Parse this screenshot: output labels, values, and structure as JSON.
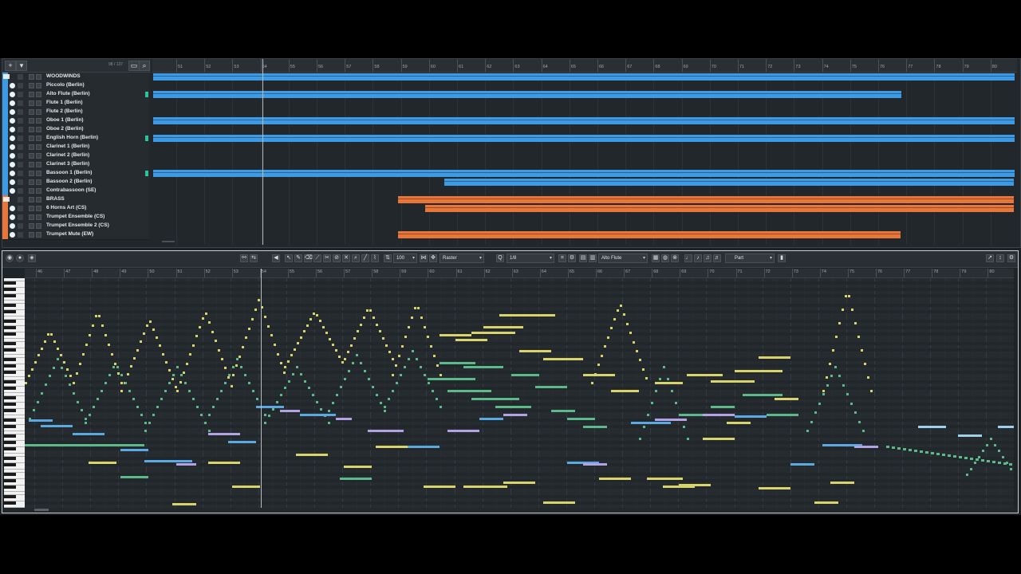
{
  "arrange": {
    "track_count": "98 / 137",
    "tracks": [
      {
        "name": "WOODWINDS",
        "kind": "folder",
        "color": "#3d9be6"
      },
      {
        "name": "Piccolo (Berlin)",
        "color": "#3d9be6"
      },
      {
        "name": "Alto Flute (Berlin)",
        "color": "#3d9be6"
      },
      {
        "name": "Flute 1 (Berlin)",
        "color": "#3d9be6"
      },
      {
        "name": "Flute 2 (Berlin)",
        "color": "#3d9be6"
      },
      {
        "name": "Oboe 1 (Berlin)",
        "color": "#3d9be6"
      },
      {
        "name": "Oboe 2 (Berlin)",
        "color": "#3d9be6"
      },
      {
        "name": "English Horn (Berlin)",
        "color": "#3d9be6"
      },
      {
        "name": "Clarinet 1 (Berlin)",
        "color": "#3d9be6"
      },
      {
        "name": "Clarinet 2 (Berlin)",
        "color": "#3d9be6"
      },
      {
        "name": "Clarinet 3 (Berlin)",
        "color": "#3d9be6"
      },
      {
        "name": "Bassoon 1 (Berlin)",
        "color": "#3d9be6"
      },
      {
        "name": "Bassoon 2 (Berlin)",
        "color": "#3d9be6"
      },
      {
        "name": "Contrabassoon (SE)",
        "color": "#3d9be6"
      },
      {
        "name": "BRASS",
        "kind": "folder",
        "color": "#e8763a"
      },
      {
        "name": "6 Horns Art (CS)",
        "color": "#e8763a"
      },
      {
        "name": "Trumpet Ensemble (CS)",
        "color": "#e8763a"
      },
      {
        "name": "Trumpet Ensemble 2 (CS)",
        "color": "#e8763a"
      },
      {
        "name": "Trumpet Mute (EW)",
        "color": "#e8763a"
      }
    ],
    "ruler_bars": [
      "51",
      "52",
      "53",
      "54",
      "55",
      "56",
      "57",
      "58",
      "59",
      "60",
      "61",
      "62",
      "63",
      "64",
      "65",
      "66",
      "67",
      "68",
      "69",
      "70",
      "71",
      "72",
      "73",
      "74",
      "75",
      "76",
      "77",
      "78",
      "79",
      "80"
    ]
  },
  "editor": {
    "quantize_length": "100",
    "grid_type": "Raster",
    "quantize": "1/8",
    "instrument": "Alto Flute",
    "part_mode": "Part",
    "ruler_bars": [
      "46",
      "47",
      "48",
      "49",
      "50",
      "51",
      "52",
      "53",
      "54",
      "55",
      "56",
      "57",
      "58",
      "59",
      "60",
      "61",
      "62",
      "63",
      "64",
      "65",
      "66",
      "67",
      "68",
      "69",
      "70",
      "71",
      "72",
      "73",
      "74",
      "75",
      "76",
      "77",
      "78",
      "79",
      "80"
    ]
  },
  "colors": {
    "woodwinds": "#3d9be6",
    "brass": "#e8763a",
    "note_yellow": "#d8d36a",
    "note_green": "#5cb98a",
    "note_blue": "#5aa9e0",
    "note_purple": "#b3a3e6"
  }
}
